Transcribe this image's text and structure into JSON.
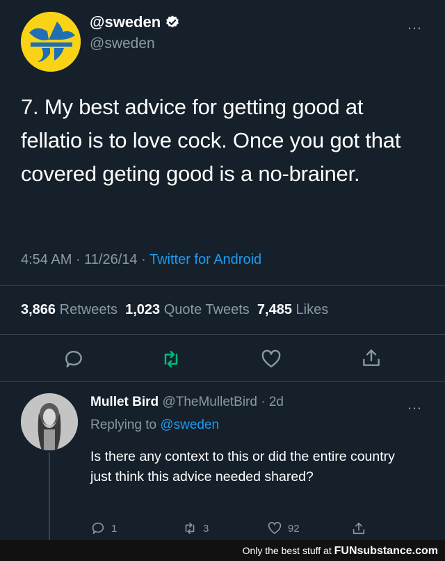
{
  "tweet": {
    "display_name": "@sweden",
    "handle": "@sweden",
    "more_label": "…",
    "text": "7. My best advice for getting good at fellatio is to love cock. Once you got that covered geting good is a no-brainer.",
    "time": "4:54 AM",
    "date": "11/26/14",
    "client": "Twitter for Android",
    "stats": {
      "retweets_count": "3,866",
      "retweets_label": "Retweets",
      "quotes_count": "1,023",
      "quotes_label": "Quote Tweets",
      "likes_count": "7,485",
      "likes_label": "Likes"
    }
  },
  "reply": {
    "display_name": "Mullet Bird",
    "handle": "@TheMulletBird",
    "age": "2d",
    "replying_prefix": "Replying to",
    "replying_to": "@sweden",
    "text": "Is there any context to this or did the entire country just think this advice needed shared?",
    "reply_count": "1",
    "retweet_count": "3",
    "like_count": "92",
    "more_label": "…"
  },
  "footer": {
    "tagline": "Only the best stuff at",
    "brand": "FUNsubstance.com"
  },
  "colors": {
    "background": "#15202b",
    "accent": "#1d9bf0",
    "retweet_green": "#00ba7c",
    "avatar_yellow": "#fbd316"
  }
}
